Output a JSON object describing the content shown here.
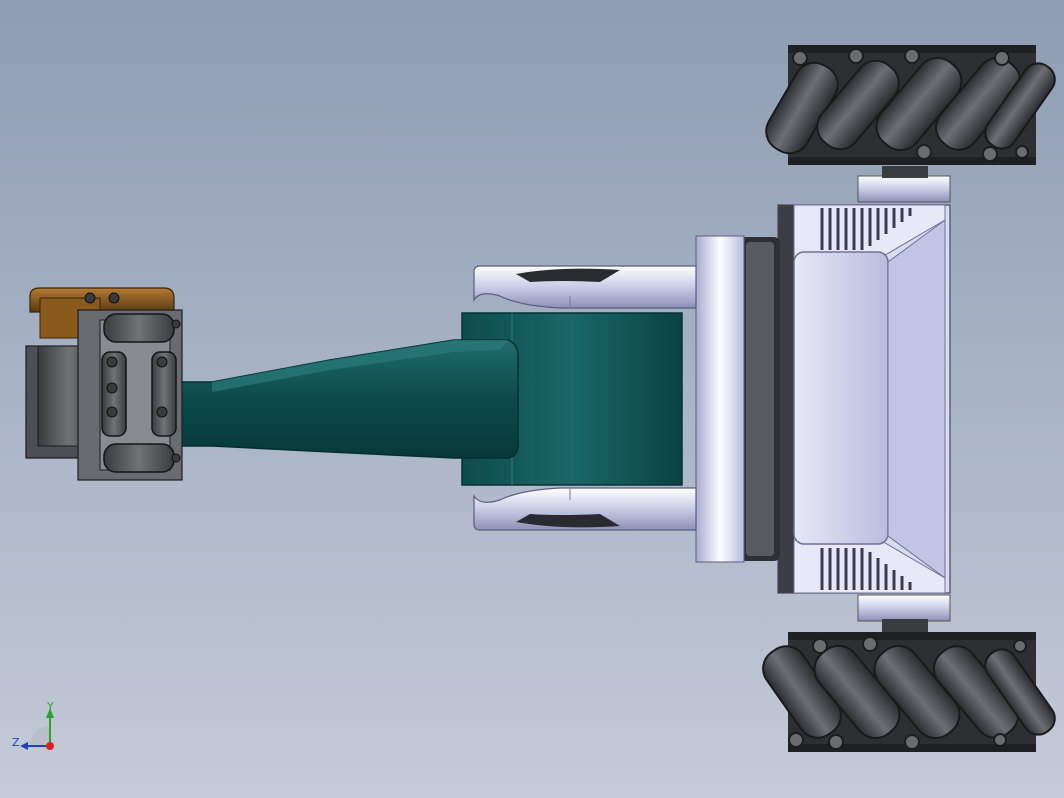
{
  "viewport": {
    "background_top": "#8e9db3",
    "background_bottom": "#c2c9d6"
  },
  "model": {
    "arm_color": "#0f4f50",
    "body_color": "#c9cbe6",
    "wheel_roller_color": "#4a4b4f",
    "gripper_accent": "#8a5a1c"
  },
  "triad": {
    "y_label": "Y",
    "z_label": "Z",
    "y_axis_color": "#2fa02f",
    "z_axis_color": "#2040c0",
    "origin_color": "#e02020"
  }
}
